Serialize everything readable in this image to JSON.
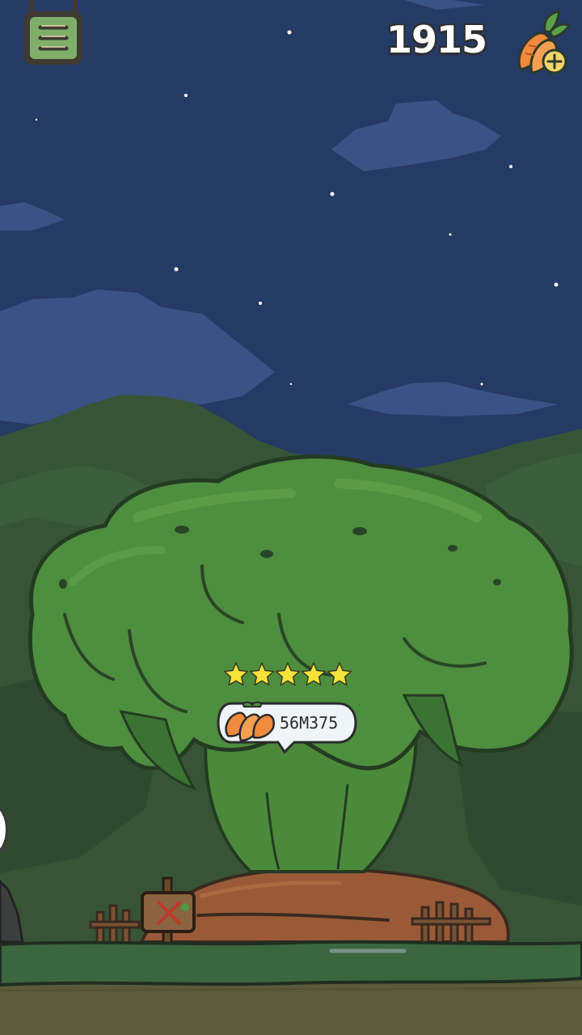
{
  "hud": {
    "carrot_count": "1915",
    "menu_icon": "menu-board-icon",
    "currency_icon": "carrot-add-icon"
  },
  "field": {
    "rating_stars": 5,
    "rating_max": 5,
    "harvest_amount": "56M375",
    "harvest_icon": "carrot-bundle-icon",
    "sign_icon": "sign-x-icon"
  },
  "colors": {
    "sky": "#263a66",
    "cloud": "#3a5286",
    "forest": "#3b5b3c",
    "tree_crown": "#4c8e3e",
    "soil": "#9a5a38",
    "grass": "#3b6740",
    "star": "#f5e23a"
  }
}
